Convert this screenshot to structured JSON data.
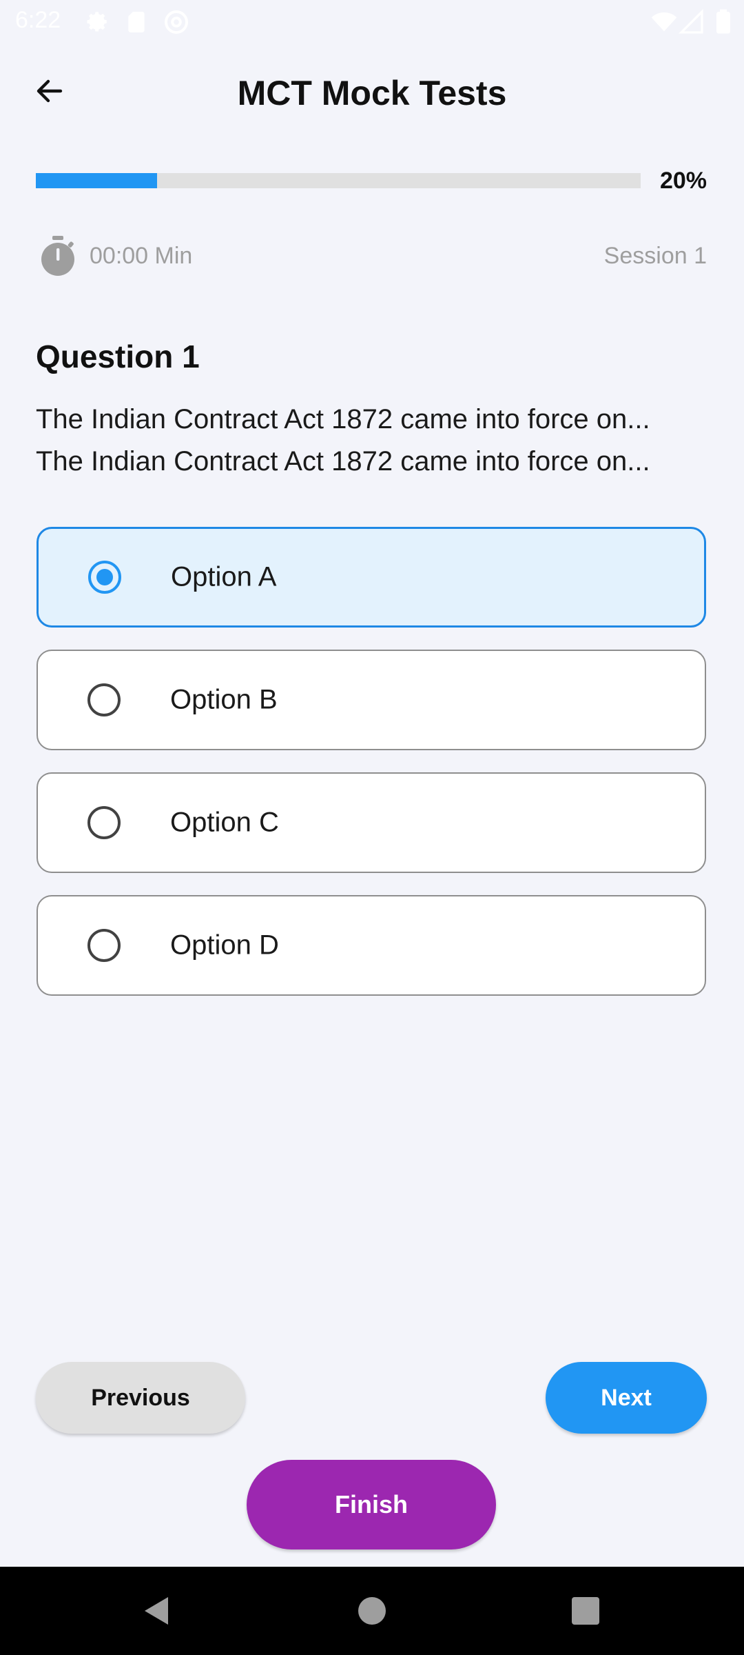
{
  "status_bar": {
    "time": "6:22",
    "left_icons": [
      "gear-icon",
      "sim-card-icon",
      "at-sign-icon"
    ],
    "right_icons": [
      "wifi-icon",
      "cell-signal-icon",
      "battery-icon"
    ]
  },
  "app_bar": {
    "title": "MCT Mock Tests",
    "back_icon": "arrow-left-icon"
  },
  "progress": {
    "value_percent": 20,
    "label": "20%",
    "color": "#2196F3"
  },
  "timer": {
    "icon": "stopwatch-icon",
    "text": "00:00 Min"
  },
  "session": {
    "label": "Session 1"
  },
  "question": {
    "title": "Question 1",
    "lines": [
      "The Indian Contract Act 1872 came into force on...",
      "The Indian Contract Act 1872 came into force on..."
    ]
  },
  "options": [
    {
      "label": "Option A",
      "selected": true
    },
    {
      "label": "Option B",
      "selected": false
    },
    {
      "label": "Option C",
      "selected": false
    },
    {
      "label": "Option D",
      "selected": false
    }
  ],
  "buttons": {
    "previous": "Previous",
    "next": "Next",
    "finish": "Finish"
  },
  "colors": {
    "background": "#F3F4FA",
    "accent": "#2196F3",
    "finish": "#9C27B0",
    "selected_option_bg": "#E3F2FD"
  },
  "nav_bar": {
    "icons": [
      "back-triangle-icon",
      "home-circle-icon",
      "recents-square-icon"
    ]
  }
}
